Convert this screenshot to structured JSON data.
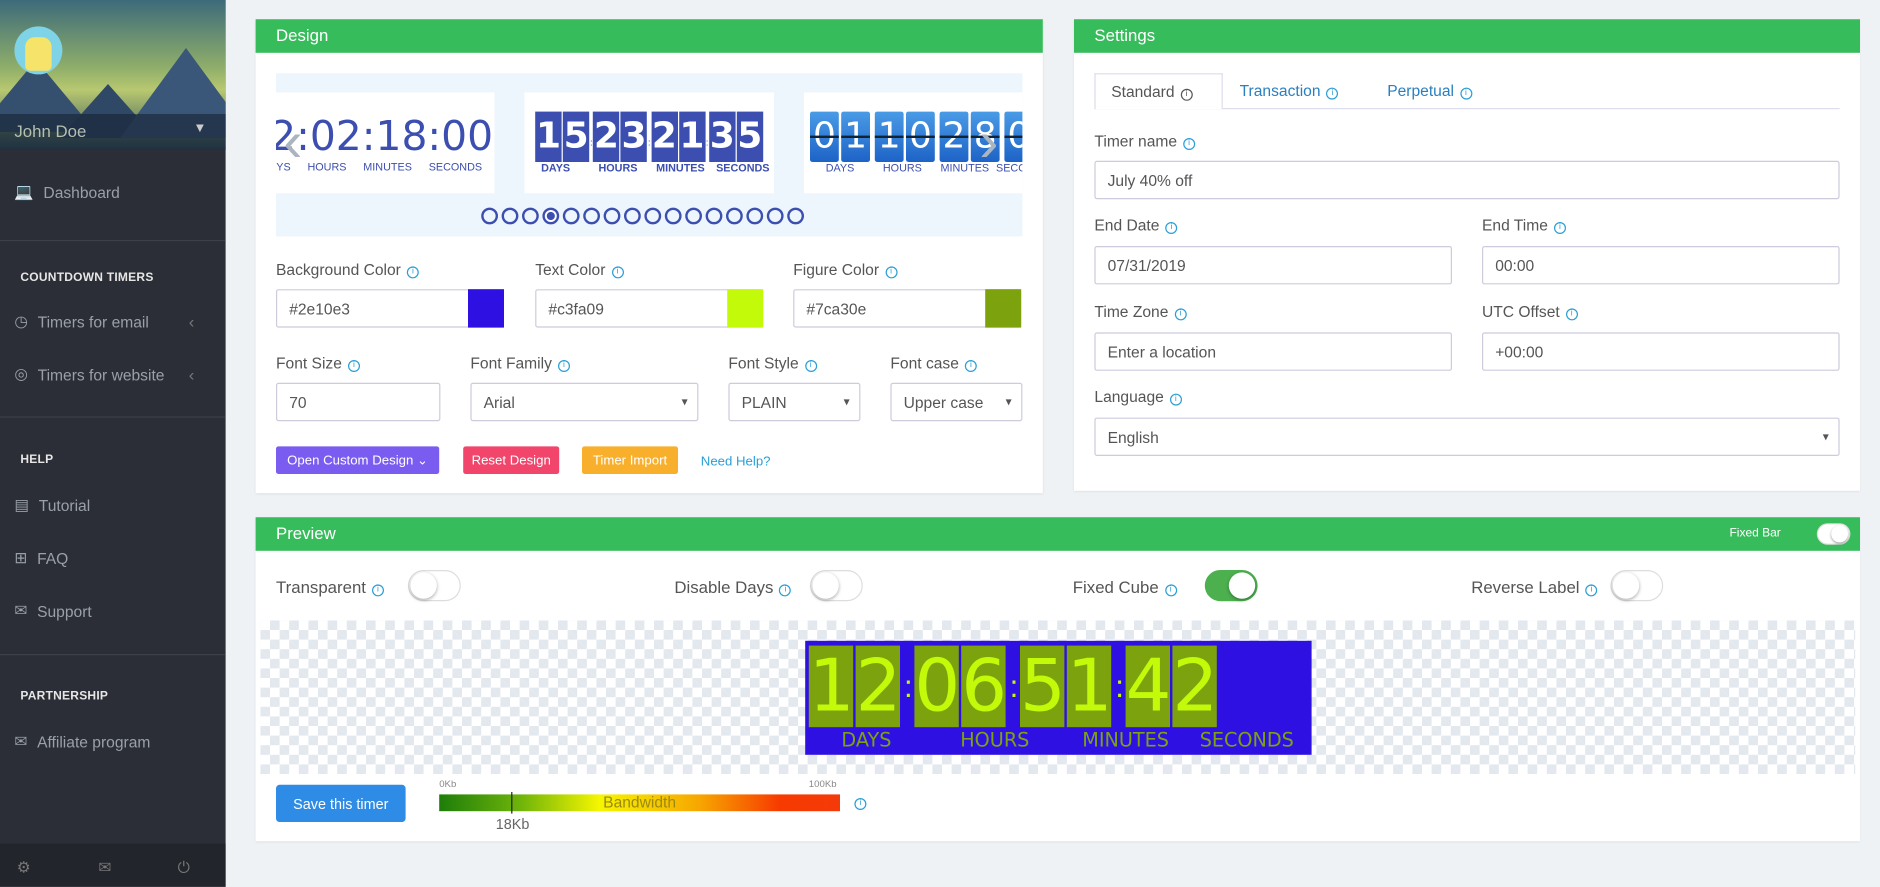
{
  "sidebar": {
    "user_name": "John Doe",
    "dashboard": "Dashboard",
    "sections": [
      {
        "title": "COUNTDOWN TIMERS",
        "items": [
          "Timers for email",
          "Timers for website"
        ]
      },
      {
        "title": "HELP",
        "items": [
          "Tutorial",
          "FAQ",
          "Support"
        ]
      },
      {
        "title": "PARTNERSHIP",
        "items": [
          "Affiliate program"
        ]
      }
    ]
  },
  "design": {
    "title": "Design",
    "carousel": {
      "slide1": {
        "digits": "2:02:18:00",
        "labels": [
          "YS",
          "HOURS",
          "MINUTES",
          "SECONDS"
        ]
      },
      "slide2": {
        "groups": [
          "15",
          "23",
          "21",
          "35"
        ],
        "labels": [
          "DAYS",
          "HOURS",
          "MINUTES",
          "SECONDS"
        ]
      },
      "slide3": {
        "groups": [
          "01",
          "10",
          "28",
          "0"
        ],
        "labels": [
          "DAYS",
          "HOURS",
          "MINUTES",
          "SECO"
        ]
      },
      "dot_count": 16,
      "active_dot": 4
    },
    "background_color": {
      "label": "Background Color",
      "value": "#2e10e3"
    },
    "text_color": {
      "label": "Text Color",
      "value": "#c3fa09"
    },
    "figure_color": {
      "label": "Figure Color",
      "value": "#7ca30e"
    },
    "font_size": {
      "label": "Font Size",
      "value": "70"
    },
    "font_family": {
      "label": "Font Family",
      "value": "Arial"
    },
    "font_style": {
      "label": "Font Style",
      "value": "PLAIN"
    },
    "font_case": {
      "label": "Font case",
      "value": "Upper case"
    },
    "buttons": {
      "custom": "Open Custom Design",
      "reset": "Reset Design",
      "import": "Timer Import",
      "help": "Need Help?"
    }
  },
  "settings": {
    "title": "Settings",
    "tabs": [
      "Standard",
      "Transaction",
      "Perpetual"
    ],
    "active_tab": 0,
    "timer_name": {
      "label": "Timer name",
      "value": "July 40% off"
    },
    "end_date": {
      "label": "End Date",
      "value": "07/31/2019"
    },
    "end_time": {
      "label": "End Time",
      "value": "00:00"
    },
    "time_zone": {
      "label": "Time Zone",
      "placeholder": "Enter a location"
    },
    "utc_offset": {
      "label": "UTC Offset",
      "value": "+00:00"
    },
    "language": {
      "label": "Language",
      "value": "English"
    }
  },
  "preview": {
    "title": "Preview",
    "fixed_bar": {
      "label": "Fixed Bar",
      "on": true
    },
    "toggles": [
      {
        "label": "Transparent",
        "on": false
      },
      {
        "label": "Disable Days",
        "on": false
      },
      {
        "label": "Fixed Cube",
        "on": true
      },
      {
        "label": "Reverse Label",
        "on": false
      }
    ],
    "timer": {
      "groups": [
        "12",
        "06",
        "51",
        "42"
      ],
      "labels": [
        "DAYS",
        "HOURS",
        "MINUTES",
        "SECONDS"
      ]
    },
    "save": "Save this timer",
    "bandwidth": {
      "label": "Bandwidth",
      "min": "0Kb",
      "max": "100Kb",
      "value": "18Kb",
      "fraction": 0.18
    }
  }
}
